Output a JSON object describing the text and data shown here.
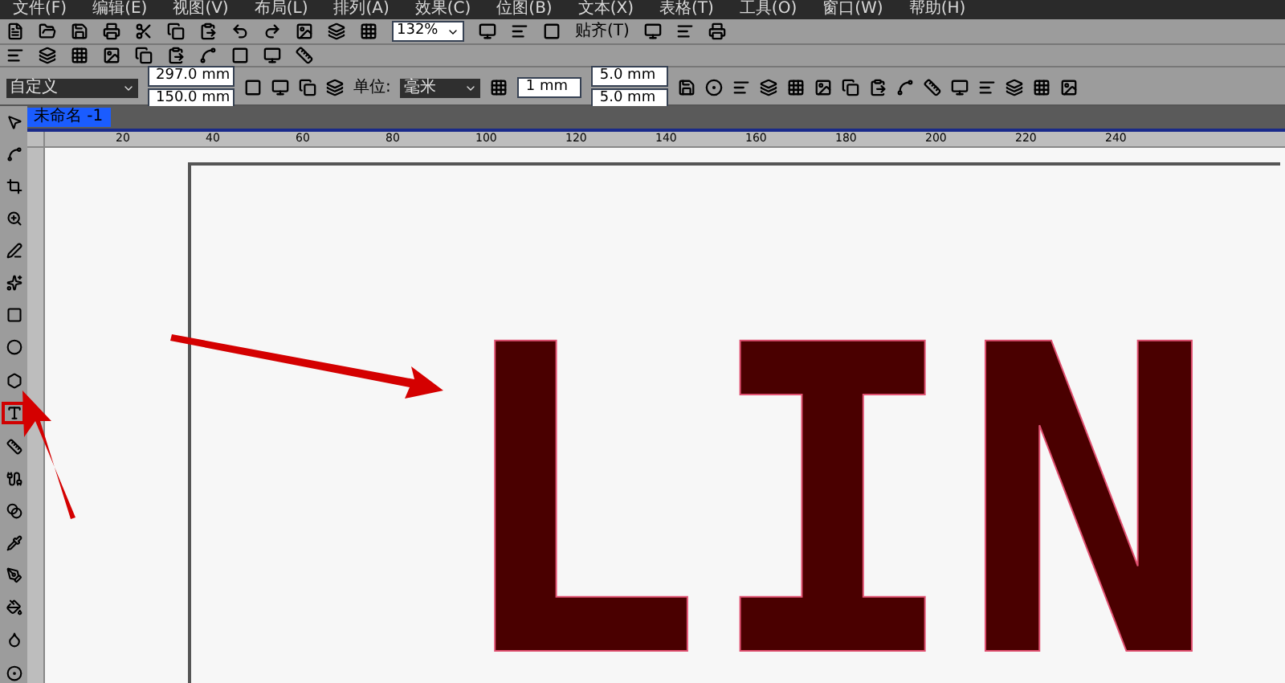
{
  "menu": [
    "文件(F)",
    "编辑(E)",
    "视图(V)",
    "布局(L)",
    "排列(A)",
    "效果(C)",
    "位图(B)",
    "文本(X)",
    "表格(T)",
    "工具(O)",
    "窗口(W)",
    "帮助(H)"
  ],
  "standard_toolbar": {
    "zoom": "132%",
    "snap": "贴齐(T)"
  },
  "property_bar": {
    "preset": "自定义",
    "width": "297.0 mm",
    "height": "150.0 mm",
    "units_label": "单位:",
    "units": "毫米",
    "nudge": "1 mm",
    "dup_x": "5.0 mm",
    "dup_y": "5.0 mm"
  },
  "document_tab": {
    "title": "未命名 -1"
  },
  "ruler_labels": [
    "20",
    "40",
    "60",
    "80",
    "100",
    "120",
    "140",
    "160",
    "180",
    "200",
    "220",
    "240"
  ],
  "toolbox": [
    {
      "kind": "pick",
      "highlighted": false
    },
    {
      "kind": "shape",
      "highlighted": false
    },
    {
      "kind": "crop",
      "highlighted": false
    },
    {
      "kind": "zoom",
      "highlighted": false
    },
    {
      "kind": "freehand",
      "highlighted": false
    },
    {
      "kind": "smart",
      "highlighted": false
    },
    {
      "kind": "rectangle",
      "highlighted": false
    },
    {
      "kind": "ellipse",
      "highlighted": false
    },
    {
      "kind": "polygon",
      "highlighted": false
    },
    {
      "kind": "text",
      "highlighted": true
    },
    {
      "kind": "dimension",
      "highlighted": false
    },
    {
      "kind": "connector",
      "highlighted": false
    },
    {
      "kind": "blend",
      "highlighted": false
    },
    {
      "kind": "eyedropper",
      "highlighted": false
    },
    {
      "kind": "pen",
      "highlighted": false
    },
    {
      "kind": "fill",
      "highlighted": false
    },
    {
      "kind": "bucket",
      "highlighted": false
    },
    {
      "kind": "interactive",
      "highlighted": false
    }
  ],
  "canvas_text": "LIN"
}
